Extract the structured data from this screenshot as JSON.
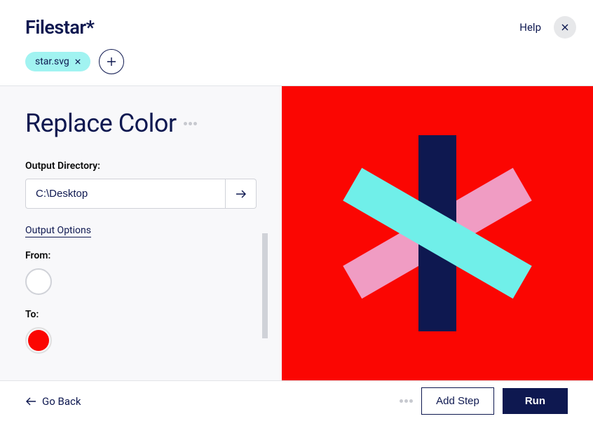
{
  "header": {
    "logo_text": "Filestar",
    "logo_star": "*",
    "help_label": "Help"
  },
  "files": {
    "chips": [
      {
        "name": "star.svg"
      }
    ]
  },
  "page": {
    "title": "Replace Color"
  },
  "form": {
    "output_directory_label": "Output Directory:",
    "output_directory_value": "C:\\Desktop",
    "output_options_label": "Output Options",
    "from_label": "From:",
    "to_label": "To:",
    "from_color": "#ffffff",
    "to_color": "#fb0602"
  },
  "preview": {
    "background_color": "#fb0602"
  },
  "footer": {
    "go_back_label": "Go Back",
    "add_step_label": "Add Step",
    "run_label": "Run"
  }
}
